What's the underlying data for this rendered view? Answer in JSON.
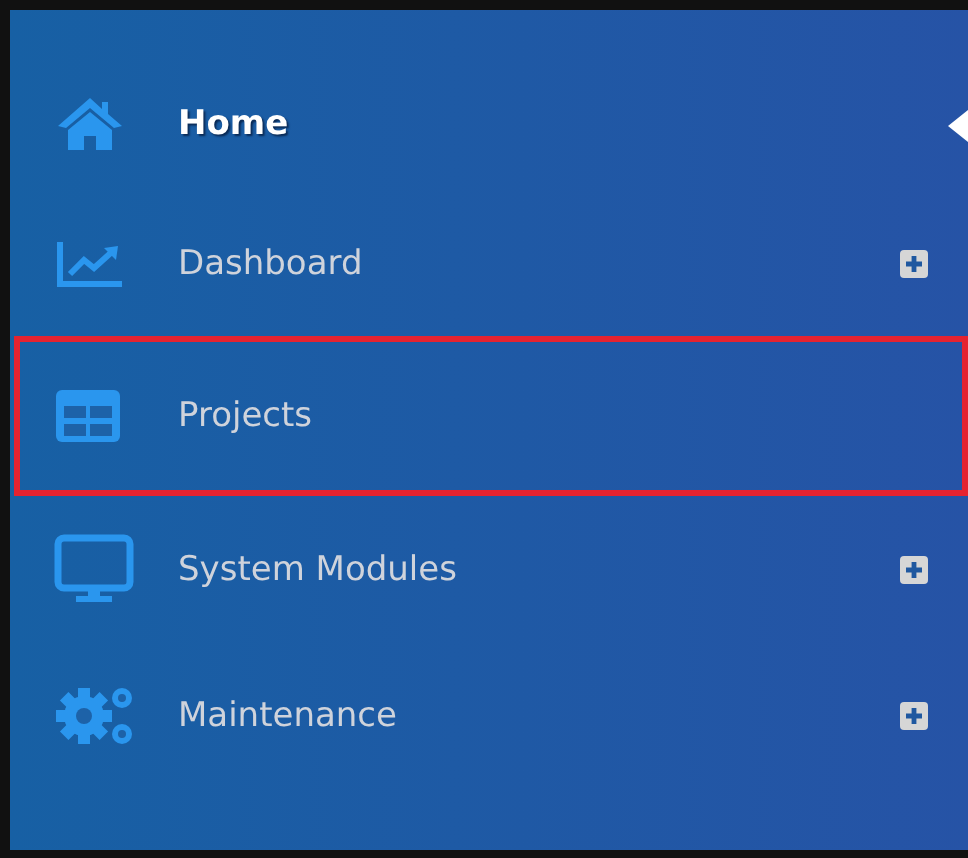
{
  "menu": [
    {
      "label": "Home",
      "selected": true,
      "highlighted": false,
      "expandable": false
    },
    {
      "label": "Dashboard",
      "selected": false,
      "highlighted": false,
      "expandable": true
    },
    {
      "label": "Projects",
      "selected": false,
      "highlighted": true,
      "expandable": false
    },
    {
      "label": "System Modules",
      "selected": false,
      "highlighted": false,
      "expandable": true
    },
    {
      "label": "Maintenance",
      "selected": false,
      "highlighted": false,
      "expandable": true
    }
  ]
}
